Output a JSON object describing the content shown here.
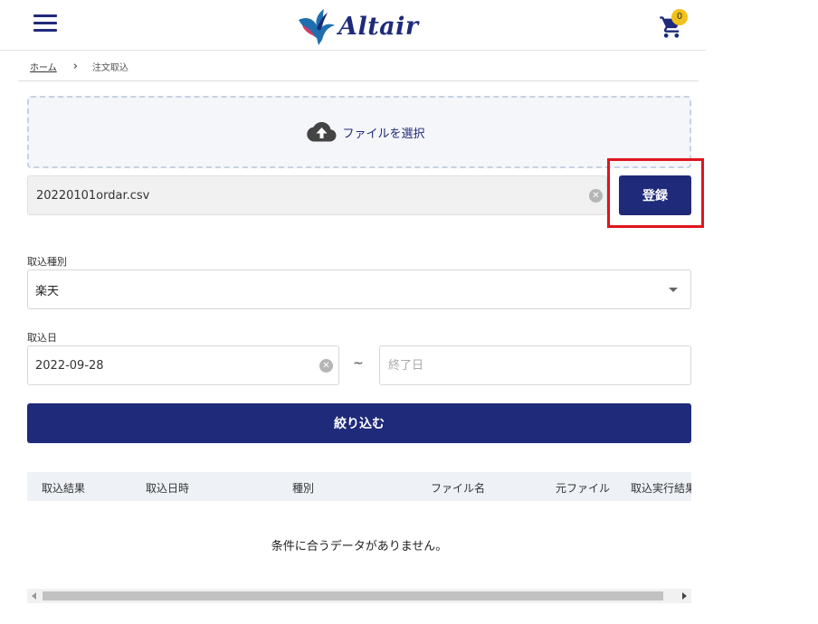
{
  "header": {
    "logo_text": "Altair",
    "cart_count": "0"
  },
  "breadcrumb": {
    "home": "ホーム",
    "separator": "›",
    "current": "注文取込"
  },
  "upload": {
    "select_file_label": "ファイルを選択",
    "file_value": "20220101ordar.csv",
    "register_label": "登録"
  },
  "form": {
    "import_type_label": "取込種別",
    "import_type_value": "楽天",
    "import_date_label": "取込日",
    "date_start": "2022-09-28",
    "date_separator": "~",
    "date_end_placeholder": "終了日",
    "filter_label": "絞り込む"
  },
  "table": {
    "headers": [
      "取込結果",
      "取込日時",
      "種別",
      "ファイル名",
      "元ファイル",
      "取込実行結果"
    ],
    "empty_message": "条件に合うデータがありません。"
  },
  "colors": {
    "primary": "#1f2a7a",
    "highlight": "#e0141e",
    "badge": "#f0c21a"
  }
}
